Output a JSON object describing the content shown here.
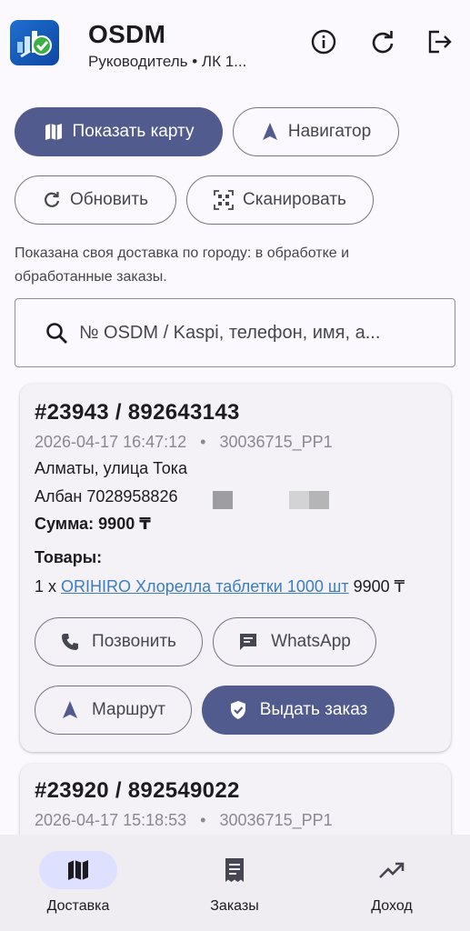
{
  "header": {
    "title": "OSDM",
    "subtitle": "Руководитель • ЛК 1...",
    "icons": [
      "info-icon",
      "refresh-icon",
      "logout-icon"
    ]
  },
  "actions": {
    "show_map": "Показать карту",
    "navigator": "Навигатор",
    "refresh": "Обновить",
    "scan": "Сканировать"
  },
  "info_text": "Показана своя доставка по городу: в обработке и обработанные заказы.",
  "search": {
    "placeholder": "№ OSDM / Kaspi, телефон, имя, а..."
  },
  "orders": [
    {
      "number": "#23943 / 892643143",
      "datetime": "2026-04-17 16:47:12",
      "code": "30036715_PP1",
      "address": "Алматы, улица Тока",
      "contact": "Албан 7028958826",
      "sum_label": "Сумма: 9900 ₸",
      "goods_label": "Товары:",
      "item_qty": "1 x",
      "item_name": "ORIHIRO Хлорелла таблетки 1000 шт",
      "item_price": "9900 ₸",
      "buttons": {
        "call": "Позвонить",
        "whatsapp": "WhatsApp",
        "route": "Маршрут",
        "issue": "Выдать заказ"
      }
    },
    {
      "number": "#23920 / 892549022",
      "datetime": "2026-04-17 15:18:53",
      "code": "30036715_PP1"
    }
  ],
  "bottom_nav": [
    {
      "label": "Доставка",
      "icon": "map-icon",
      "active": true
    },
    {
      "label": "Заказы",
      "icon": "receipt-icon",
      "active": false
    },
    {
      "label": "Доход",
      "icon": "trending-up-icon",
      "active": false
    }
  ],
  "colors": {
    "primary": "#515b8e",
    "background": "#fbf9fd",
    "card": "#f4f2f7",
    "nav_active": "#dee0ff",
    "link": "#3a7ec1"
  }
}
